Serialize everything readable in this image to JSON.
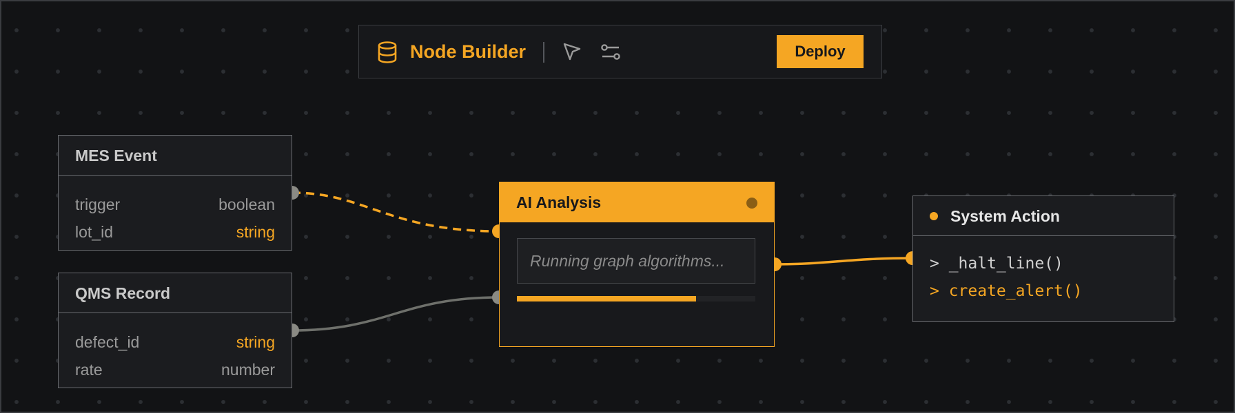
{
  "toolbar": {
    "title": "Node Builder",
    "deploy_label": "Deploy",
    "icons": [
      "database-icon",
      "cursor-icon",
      "sliders-icon"
    ]
  },
  "nodes": {
    "mes_event": {
      "title": "MES Event",
      "fields": [
        {
          "name": "trigger",
          "type": "boolean"
        },
        {
          "name": "lot_id",
          "type": "string"
        }
      ]
    },
    "qms_record": {
      "title": "QMS Record",
      "fields": [
        {
          "name": "defect_id",
          "type": "string"
        },
        {
          "name": "rate",
          "type": "number"
        }
      ]
    },
    "ai_analysis": {
      "title": "AI Analysis",
      "placeholder": "Running graph algorithms...",
      "progress": 0.75
    },
    "system_action": {
      "title": "System Action",
      "commands": [
        "> _halt_line()",
        "> create_alert()"
      ]
    }
  },
  "colors": {
    "accent": "#f5a623",
    "background": "#121315",
    "muted_wire": "#6e706b",
    "port_gray": "#8a8a84"
  }
}
